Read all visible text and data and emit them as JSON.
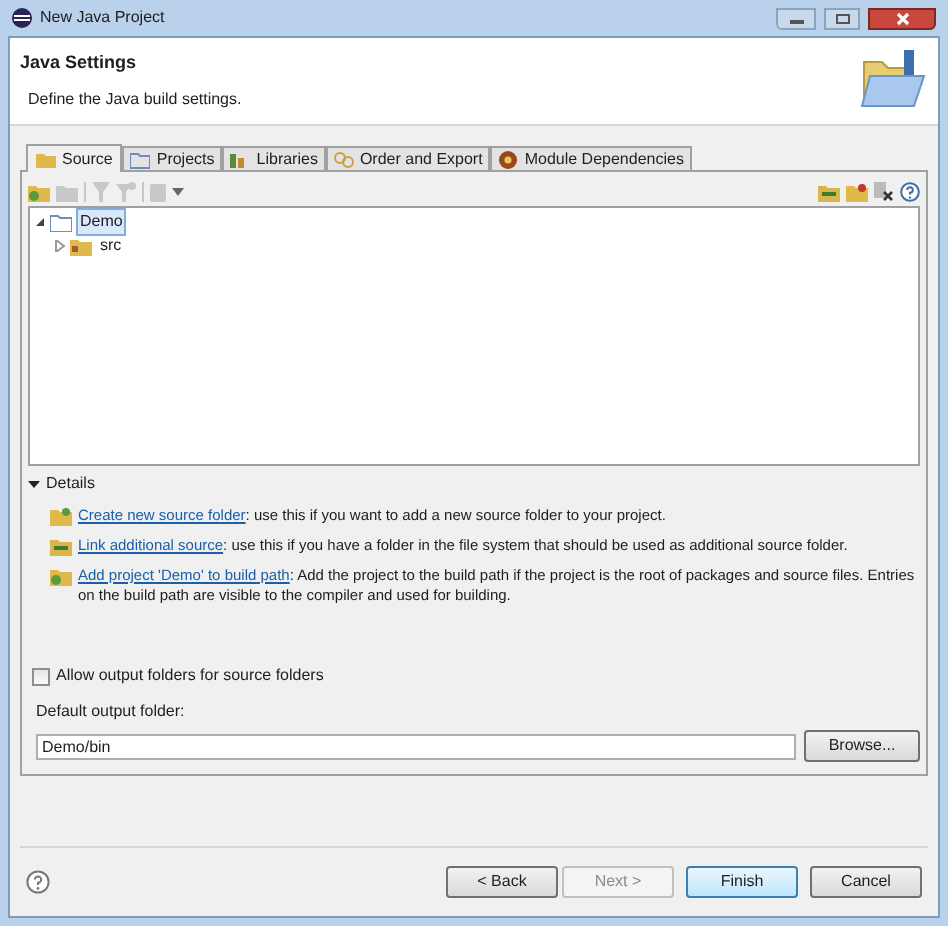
{
  "window": {
    "title": "New Java Project"
  },
  "header": {
    "title": "Java Settings",
    "description": "Define the Java build settings."
  },
  "tabs": [
    {
      "label": "Source",
      "selected": true
    },
    {
      "label": "Projects",
      "selected": false
    },
    {
      "label": "Libraries",
      "selected": false
    },
    {
      "label": "Order and Export",
      "selected": false
    },
    {
      "label": "Module Dependencies",
      "selected": false
    }
  ],
  "tree": [
    {
      "label": "Demo",
      "expanded": true,
      "selected": true,
      "children": [
        {
          "label": "src",
          "expanded": false,
          "selected": false
        }
      ]
    }
  ],
  "details": {
    "label": "Details",
    "expanded": true,
    "items": [
      {
        "link": "Create new source folder",
        "text": ": use this if you want to add a new source folder to your project."
      },
      {
        "link": "Link additional source",
        "text": ": use this if you have a folder in the file system that should be used as additional source folder."
      },
      {
        "link": "Add project 'Demo' to build path",
        "text": ": Add the project to the build path if the project is the root of packages and source files. Entries on the build path are visible to the compiler and used for building."
      }
    ]
  },
  "allow_output_folders": {
    "label": "Allow output folders for source folders",
    "checked": false
  },
  "default_output": {
    "label": "Default output folder:",
    "value": "Demo/bin"
  },
  "browse_button": "Browse...",
  "buttons": [
    {
      "label": "< Back",
      "disabled": false,
      "default": false
    },
    {
      "label": "Next >",
      "disabled": true,
      "default": false
    },
    {
      "label": "Finish",
      "disabled": false,
      "default": true
    },
    {
      "label": "Cancel",
      "disabled": false,
      "default": false
    }
  ]
}
